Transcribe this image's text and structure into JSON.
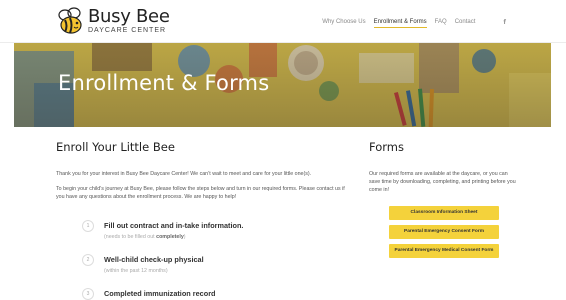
{
  "header": {
    "logo_title": "Busy Bee",
    "logo_subtitle": "DAYCARE CENTER",
    "nav": [
      "Why Choose Us",
      "Enrollment & Forms",
      "FAQ",
      "Contact"
    ],
    "social": "f"
  },
  "hero": {
    "title": "Enrollment & Forms"
  },
  "enroll": {
    "heading": "Enroll Your Little Bee",
    "para1": "Thank you for your interest in Busy Bee Daycare Center! We can’t wait to meet and care for your little one(s).",
    "para2": "To begin your child’s journey at Busy Bee, please follow the steps below and turn in our required forms. Please contact us if you have any questions about the enrollment process. We are happy to help!",
    "steps": [
      {
        "num": "1",
        "title": "Fill out contract and in-take information.",
        "note_prefix": "(needs to be filled out ",
        "note_bold": "completely",
        "note_suffix": ")"
      },
      {
        "num": "2",
        "title": "Well-child check-up physical",
        "note": "(within the past 12 months)"
      },
      {
        "num": "3",
        "title": "Completed immunization record"
      }
    ]
  },
  "forms": {
    "heading": "Forms",
    "text": "Our required forms are available at the daycare, or you can save time by downloading, completing, and printing before you come in!",
    "buttons": [
      "Classroom Information Sheet",
      "Parental Emergency Consent Form",
      "Parental Emergency Medical Consent Form"
    ]
  },
  "colors": {
    "accent": "#f4d23b"
  }
}
